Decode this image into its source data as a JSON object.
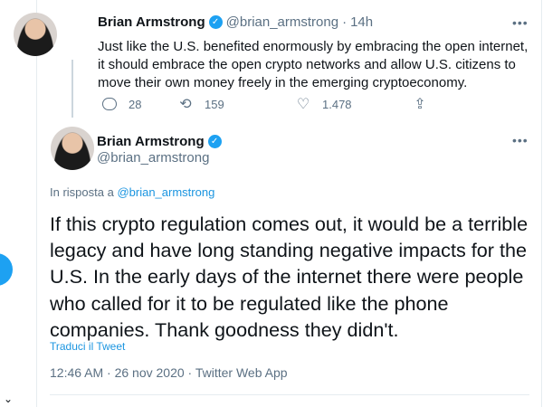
{
  "thread_tweet": {
    "name": "Brian Armstrong",
    "handle": "@brian_armstrong",
    "separator": "·",
    "time": "14h",
    "text": "Just like the U.S. benefited enormously by embracing the open internet, it should embrace the open crypto networks and allow U.S. citizens to move their own money freely in the emerging cryptoeconomy.",
    "replies": "28",
    "retweets": "159",
    "likes": "1.478"
  },
  "main_tweet": {
    "name": "Brian Armstrong",
    "handle": "@brian_armstrong",
    "reply_prefix": "In risposta a",
    "reply_handle": "@brian_armstrong",
    "text": "If this crypto regulation comes out, it would be a terrible legacy and have long standing negative impacts for the U.S. In the early days of the internet there were people who called for it to be regulated like the phone companies. Thank goodness they didn't.",
    "translate_label": "Traduci il Tweet",
    "timestamp": "12:46 AM · 26 nov 2020 · Twitter Web App"
  },
  "icons": {
    "verified": "verified-badge-icon",
    "more": "more-icon",
    "reply": "reply-icon",
    "retweet": "retweet-icon",
    "like": "heart-icon",
    "share": "share-icon"
  },
  "colors": {
    "accent": "#1da1f2",
    "link": "#1b95e0",
    "secondary_text": "#5b7083",
    "primary_text": "#0f1419"
  }
}
